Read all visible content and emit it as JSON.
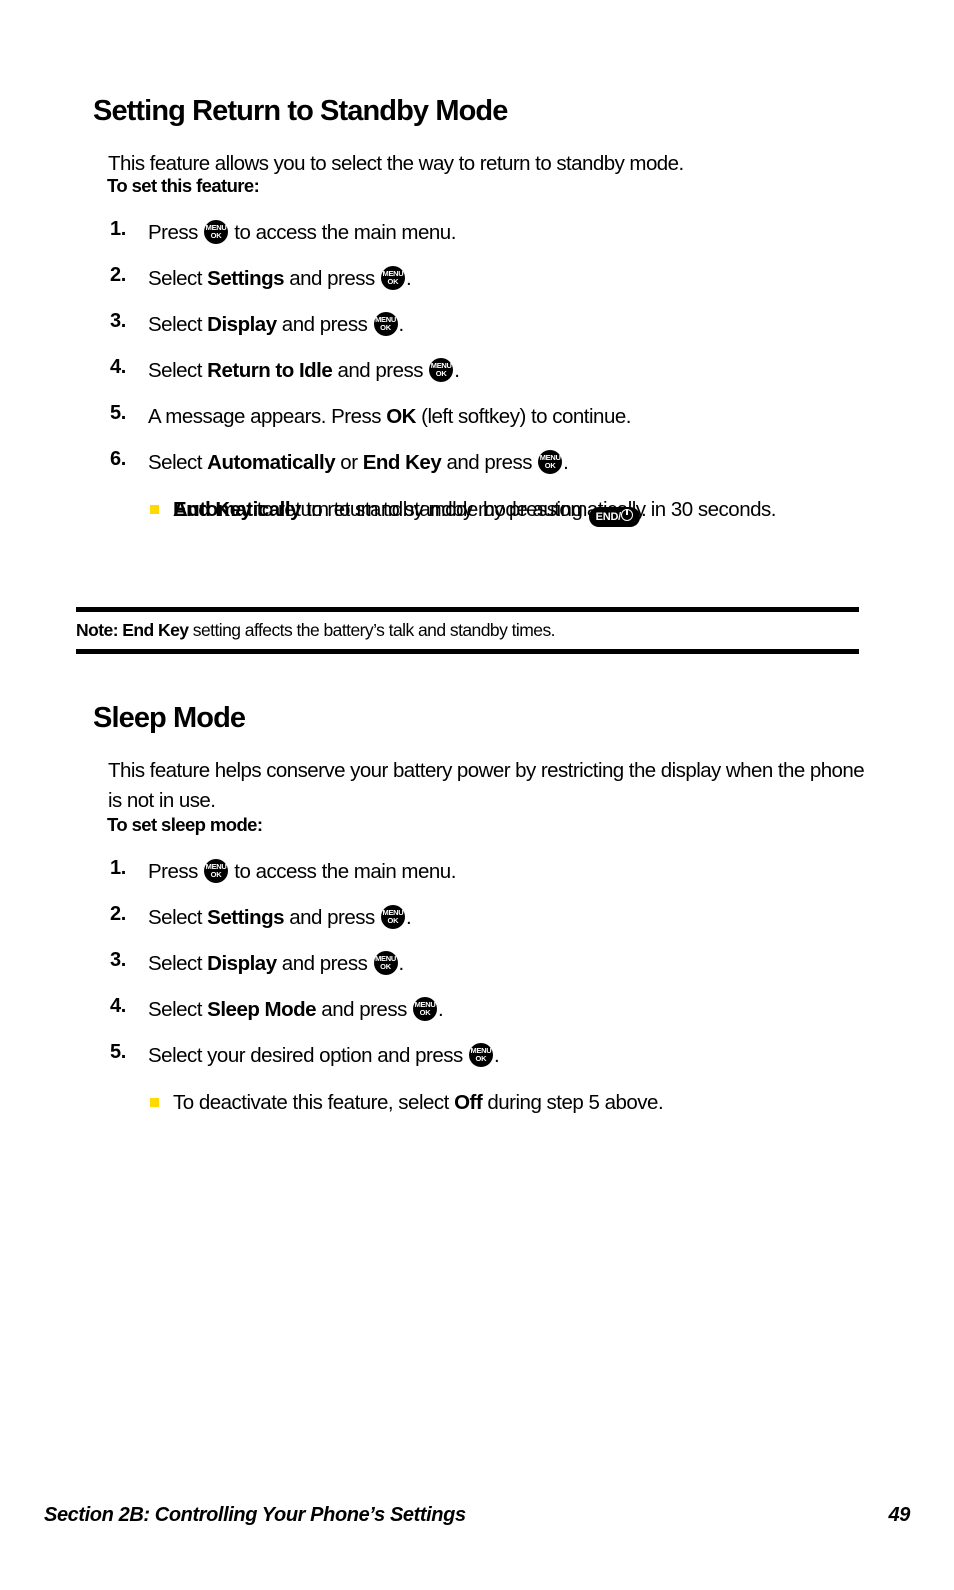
{
  "document": {
    "page_number": "49",
    "footer_section": "Section 2B: Controlling Your Phone’s Settings",
    "bullet_color": "#FFD900"
  },
  "icons": {
    "menu_key": {
      "name": "menu-ok-key-icon",
      "top_label": "MENU",
      "bottom_label": "OK"
    },
    "end_key": {
      "name": "end-power-key-icon",
      "label": "END/"
    }
  },
  "sections": [
    {
      "id": "standby",
      "heading": "Setting Return to Standby Mode",
      "intro": "This feature allows you to select the way to return to standby mode.",
      "lead_label": "To set this feature:",
      "steps": [
        {
          "num": "1.",
          "parts": [
            {
              "t": "text",
              "v": "Press "
            },
            {
              "t": "menu-key"
            },
            {
              "t": "text",
              "v": " to access the main menu."
            }
          ]
        },
        {
          "num": "2.",
          "parts": [
            {
              "t": "text",
              "v": "Select "
            },
            {
              "t": "bold",
              "v": "Settings"
            },
            {
              "t": "text",
              "v": " and press "
            },
            {
              "t": "menu-key"
            },
            {
              "t": "text",
              "v": "."
            }
          ]
        },
        {
          "num": "3.",
          "parts": [
            {
              "t": "text",
              "v": "Select "
            },
            {
              "t": "bold",
              "v": "Display"
            },
            {
              "t": "text",
              "v": " and press "
            },
            {
              "t": "menu-key"
            },
            {
              "t": "text",
              "v": "."
            }
          ]
        },
        {
          "num": "4.",
          "parts": [
            {
              "t": "text",
              "v": "Select "
            },
            {
              "t": "bold",
              "v": "Return to Idle"
            },
            {
              "t": "text",
              "v": " and press "
            },
            {
              "t": "menu-key"
            },
            {
              "t": "text",
              "v": "."
            }
          ]
        },
        {
          "num": "5.",
          "parts": [
            {
              "t": "text",
              "v": "A message appears. Press "
            },
            {
              "t": "bold",
              "v": "OK"
            },
            {
              "t": "text",
              "v": " (left softkey) to continue."
            }
          ]
        },
        {
          "num": "6.",
          "parts": [
            {
              "t": "text",
              "v": "Select "
            },
            {
              "t": "bold",
              "v": "Automatically"
            },
            {
              "t": "text",
              "v": " or "
            },
            {
              "t": "bold",
              "v": "End Key"
            },
            {
              "t": "text",
              "v": " and press "
            },
            {
              "t": "menu-key"
            },
            {
              "t": "text",
              "v": "."
            }
          ],
          "sub_bullets": [
            {
              "parts": [
                {
                  "t": "bold",
                  "v": "Automatically"
                },
                {
                  "t": "text",
                  "v": " to return to standby mode automatically in 30 seconds."
                }
              ]
            },
            {
              "parts": [
                {
                  "t": "bold",
                  "v": "End Key"
                },
                {
                  "t": "text",
                  "v": " to return to standby mode by pressing "
                },
                {
                  "t": "end-key"
                },
                {
                  "t": "text",
                  "v": "."
                }
              ]
            }
          ]
        }
      ],
      "note": {
        "parts": [
          {
            "t": "bold",
            "v": "Note:"
          },
          {
            "t": "text",
            "v": " "
          },
          {
            "t": "bold",
            "v": "End Key"
          },
          {
            "t": "text",
            "v": " setting affects the battery’s talk and standby times."
          }
        ]
      }
    },
    {
      "id": "sleep",
      "heading": "Sleep Mode",
      "intro": "This feature helps conserve your battery power by restricting the display when the phone is not in use.",
      "lead_label": "To set sleep mode:",
      "steps": [
        {
          "num": "1.",
          "parts": [
            {
              "t": "text",
              "v": "Press "
            },
            {
              "t": "menu-key"
            },
            {
              "t": "text",
              "v": " to access the main menu."
            }
          ]
        },
        {
          "num": "2.",
          "parts": [
            {
              "t": "text",
              "v": "Select "
            },
            {
              "t": "bold",
              "v": "Settings"
            },
            {
              "t": "text",
              "v": " and press "
            },
            {
              "t": "menu-key"
            },
            {
              "t": "text",
              "v": "."
            }
          ]
        },
        {
          "num": "3.",
          "parts": [
            {
              "t": "text",
              "v": "Select "
            },
            {
              "t": "bold",
              "v": "Display"
            },
            {
              "t": "text",
              "v": " and press "
            },
            {
              "t": "menu-key"
            },
            {
              "t": "text",
              "v": "."
            }
          ]
        },
        {
          "num": "4.",
          "parts": [
            {
              "t": "text",
              "v": "Select "
            },
            {
              "t": "bold",
              "v": "Sleep Mode"
            },
            {
              "t": "text",
              "v": " and press "
            },
            {
              "t": "menu-key"
            },
            {
              "t": "text",
              "v": "."
            }
          ]
        },
        {
          "num": "5.",
          "parts": [
            {
              "t": "text",
              "v": "Select your desired option and press "
            },
            {
              "t": "menu-key"
            },
            {
              "t": "text",
              "v": "."
            }
          ],
          "sub_bullets": [
            {
              "parts": [
                {
                  "t": "text",
                  "v": "To deactivate this feature, select "
                },
                {
                  "t": "bold",
                  "v": "Off"
                },
                {
                  "t": "text",
                  "v": " during step 5 above."
                }
              ]
            }
          ]
        }
      ]
    }
  ]
}
